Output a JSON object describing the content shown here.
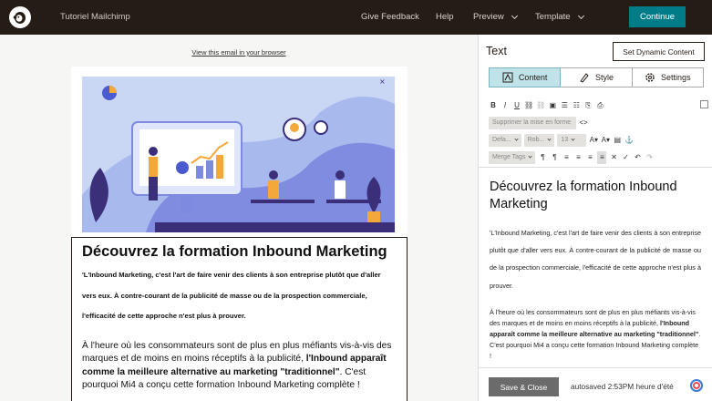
{
  "topbar": {
    "app_title": "Tutoriel Mailchimp",
    "nav": [
      "Give Feedback",
      "Help",
      "Preview",
      "Template"
    ],
    "continue_label": "Continue"
  },
  "canvas": {
    "view_link": "View this email in your browser",
    "heading": "Découvrez la formation Inbound Marketing",
    "para1": "'L'Inbound Marketing, c'est l'art de faire venir des clients à son entreprise plutôt que d'aller vers eux. À contre-courant de la publicité de masse ou de la prospection commerciale, l'efficacité de cette approche n'est plus à prouver.",
    "para2_a": "À l'heure où les consommateurs sont de plus en plus méfiants vis-à-vis des marques et de moins en moins réceptifs à la publicité, ",
    "para2_bold": "l'Inbound apparaît comme la meilleure alternative au marketing \"traditionnel\"",
    "para2_b": ". C'est pourquoi Mi4 a conçu cette formation Inbound Marketing complète !"
  },
  "panel": {
    "title": "Text",
    "dynamic_button": "Set Dynamic Content",
    "tabs": [
      "Content",
      "Style",
      "Settings"
    ],
    "clear_format": "Supprimer la mise en forme",
    "font_select": "Defa...",
    "family_select": "Rob...",
    "size_select": "13",
    "merge_tags": "Merge Tags",
    "editor_heading": "Découvrez la formation Inbound Marketing",
    "editor_para1": "'L'Inbound Marketing, c'est l'art de faire venir des clients à son entreprise plutôt que d'aller vers eux. À contre-courant de la publicité de masse ou de la prospection commerciale, l'efficacité de cette approche n'est plus à prouver.",
    "editor_para2_a": "À l'heure où les consommateurs sont de plus en plus méfiants vis-à-vis des marques et de moins en moins réceptifs à la publicité, ",
    "editor_para2_bold": "l'Inbound apparaît comme la meilleure alternative au marketing \"traditionnel\"",
    "editor_para2_b": ". C'est pourquoi Mi4 a conçu cette formation Inbound Marketing complète !",
    "save_close": "Save & Close",
    "autosaved": "autosaved 2:53PM heure d'été"
  },
  "colors": {
    "topbar_bg": "#241c15",
    "accent": "#007c89",
    "active_tab": "#bfe3e8",
    "hero_bg": "#c9d6f4"
  },
  "icons": [
    "mailchimp-logo-icon",
    "chevron-down-icon",
    "content-icon",
    "style-icon",
    "settings-gear-icon",
    "bold-icon",
    "italic-icon",
    "underline-icon",
    "link-icon",
    "unlink-icon",
    "image-icon",
    "ordered-list-icon",
    "bullet-list-icon",
    "paste-text-icon",
    "paste-word-icon",
    "source-code-icon",
    "text-color-icon",
    "background-color-icon",
    "table-icon",
    "anchor-icon",
    "paragraph-icon",
    "align-left-icon",
    "align-center-icon",
    "align-right-icon",
    "justify-icon",
    "undo-icon",
    "redo-icon"
  ]
}
